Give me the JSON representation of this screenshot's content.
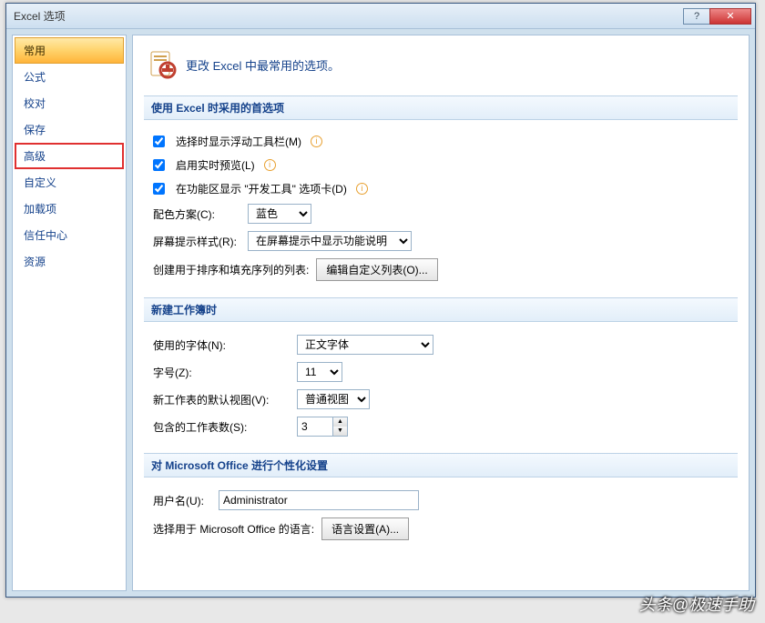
{
  "window": {
    "title": "Excel 选项"
  },
  "banner": "更改 Excel 中最常用的选项。",
  "sidebar": {
    "items": [
      {
        "label": "常用"
      },
      {
        "label": "公式"
      },
      {
        "label": "校对"
      },
      {
        "label": "保存"
      },
      {
        "label": "高级"
      },
      {
        "label": "自定义"
      },
      {
        "label": "加载项"
      },
      {
        "label": "信任中心"
      },
      {
        "label": "资源"
      }
    ]
  },
  "groups": {
    "popular": {
      "header": "使用 Excel 时采用的首选项",
      "chk_minibar": "选择时显示浮动工具栏(M)",
      "chk_preview": "启用实时预览(L)",
      "chk_devtab": "在功能区显示 \"开发工具\" 选项卡(D)",
      "colorscheme_label": "配色方案(C):",
      "colorscheme_value": "蓝色",
      "tooltip_label": "屏幕提示样式(R):",
      "tooltip_value": "在屏幕提示中显示功能说明",
      "customlists_label": "创建用于排序和填充序列的列表:",
      "customlists_btn": "编辑自定义列表(O)..."
    },
    "newbook": {
      "header": "新建工作簿时",
      "font_label": "使用的字体(N):",
      "font_value": "正文字体",
      "size_label": "字号(Z):",
      "size_value": "11",
      "view_label": "新工作表的默认视图(V):",
      "view_value": "普通视图",
      "sheets_label": "包含的工作表数(S):",
      "sheets_value": "3"
    },
    "personalize": {
      "header": "对 Microsoft Office 进行个性化设置",
      "username_label": "用户名(U):",
      "username_value": "Administrator",
      "lang_label": "选择用于 Microsoft Office 的语言:",
      "lang_btn": "语言设置(A)..."
    }
  },
  "watermark": "头条@极速手助"
}
